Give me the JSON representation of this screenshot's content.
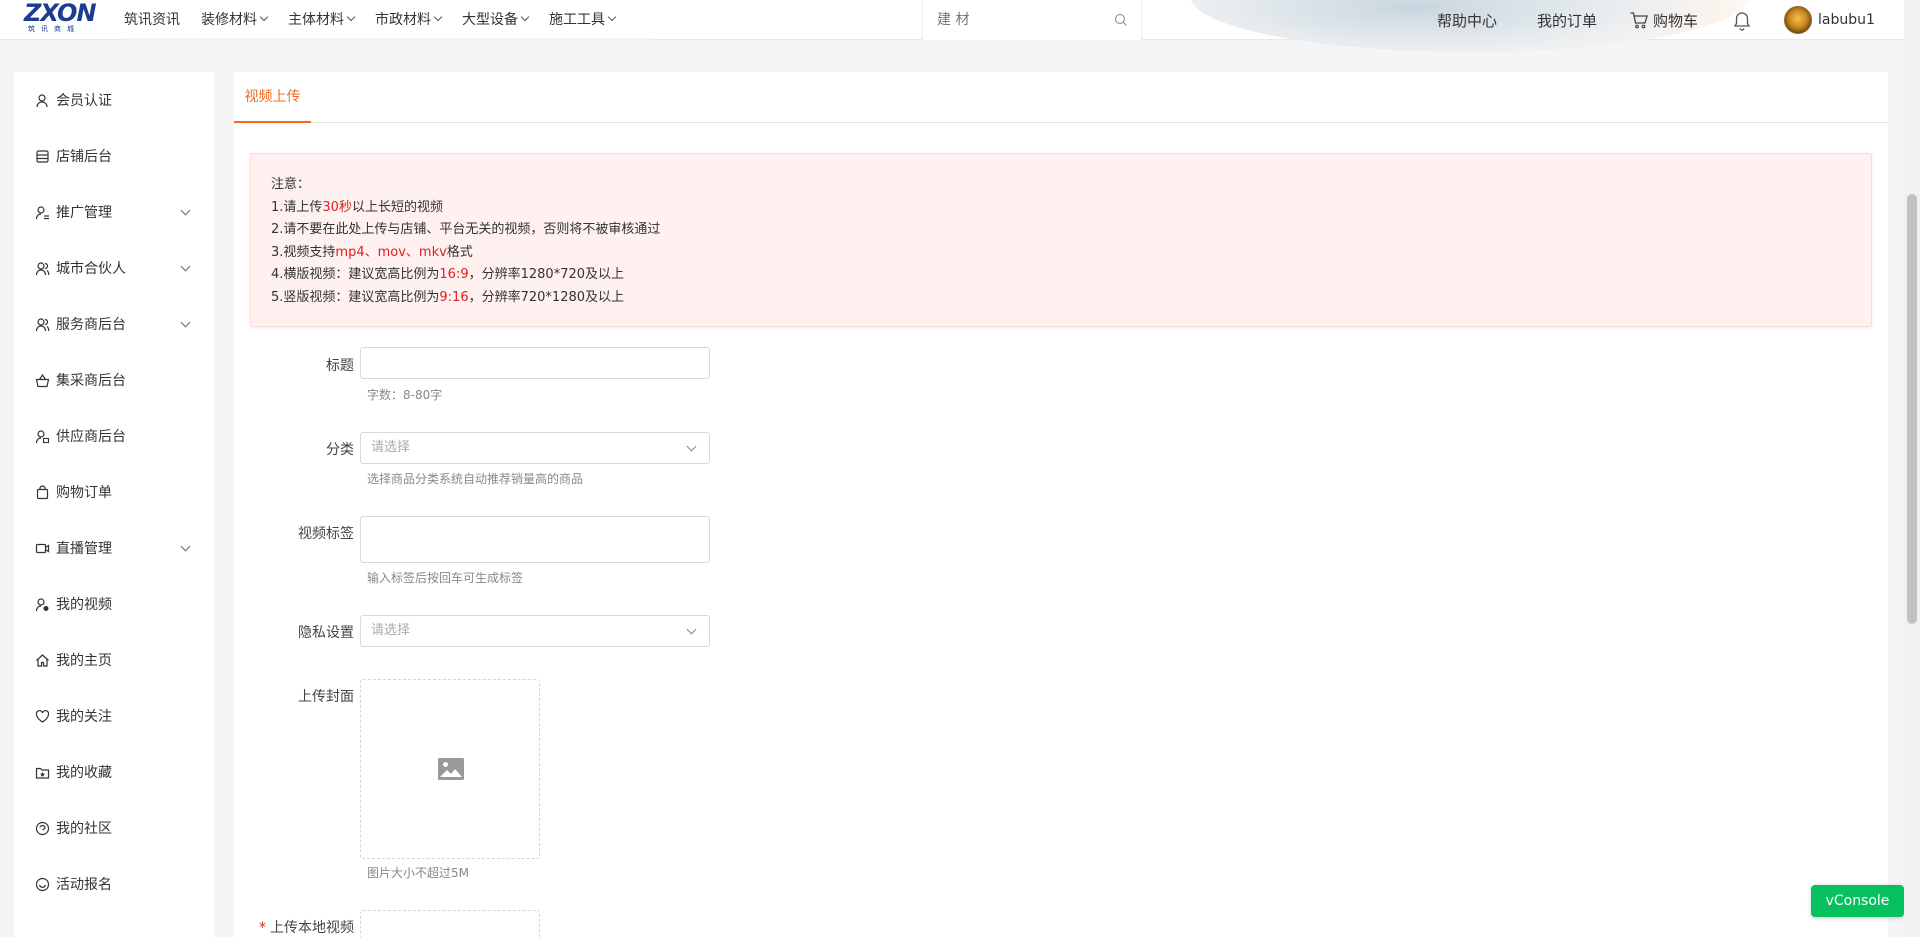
{
  "brand": {
    "logo_text": "ZXON",
    "logo_sub": "筑讯商城"
  },
  "nav": {
    "items": [
      {
        "label": "筑讯资讯",
        "has_menu": false
      },
      {
        "label": "装修材料",
        "has_menu": true
      },
      {
        "label": "主体材料",
        "has_menu": true
      },
      {
        "label": "市政材料",
        "has_menu": true
      },
      {
        "label": "大型设备",
        "has_menu": true
      },
      {
        "label": "施工工具",
        "has_menu": true
      }
    ]
  },
  "search": {
    "placeholder": "建 材",
    "icon": "search-icon"
  },
  "header_links": {
    "help": "帮助中心",
    "orders": "我的订单",
    "cart": "购物车"
  },
  "user": {
    "name": "labubu1"
  },
  "sidebar": {
    "items": [
      {
        "label": "会员认证",
        "icon": "member-icon",
        "expandable": false
      },
      {
        "label": "店铺后台",
        "icon": "store-icon",
        "expandable": false
      },
      {
        "label": "推广管理",
        "icon": "promotion-icon",
        "expandable": true
      },
      {
        "label": "城市合伙人",
        "icon": "partner-icon",
        "expandable": true
      },
      {
        "label": "服务商后台",
        "icon": "service-icon",
        "expandable": true
      },
      {
        "label": "集采商后台",
        "icon": "basket-icon",
        "expandable": false
      },
      {
        "label": "供应商后台",
        "icon": "supplier-icon",
        "expandable": false
      },
      {
        "label": "购物订单",
        "icon": "bag-icon",
        "expandable": false
      },
      {
        "label": "直播管理",
        "icon": "video-camera-icon",
        "expandable": true
      },
      {
        "label": "我的视频",
        "icon": "user-video-icon",
        "expandable": false
      },
      {
        "label": "我的主页",
        "icon": "home-icon",
        "expandable": false
      },
      {
        "label": "我的关注",
        "icon": "heart-icon",
        "expandable": false
      },
      {
        "label": "我的收藏",
        "icon": "star-folder-icon",
        "expandable": false
      },
      {
        "label": "我的社区",
        "icon": "community-icon",
        "expandable": false
      },
      {
        "label": "活动报名",
        "icon": "event-icon",
        "expandable": false
      }
    ]
  },
  "tab": {
    "label": "视频上传"
  },
  "notice": {
    "title": "注意：",
    "lines": [
      {
        "pre": "1.请上传",
        "red": "30秒",
        "post": "以上长短的视频"
      },
      {
        "pre": "2.请不要在此处上传与店铺、平台无关的视频，否则将不被审核通过",
        "red": "",
        "post": ""
      },
      {
        "pre": "3.视频支持",
        "red": "mp4、mov、mkv",
        "post": "格式"
      },
      {
        "pre": "4.横版视频：建议宽高比例为",
        "red": "16:9",
        "post": "，分辨率1280*720及以上"
      },
      {
        "pre": "5.竖版视频：建议宽高比例为",
        "red": "9:16",
        "post": "，分辨率720*1280及以上"
      }
    ]
  },
  "form": {
    "title": {
      "label": "标题",
      "hint": "字数：8-80字"
    },
    "category": {
      "label": "分类",
      "placeholder": "请选择",
      "hint": "选择商品分类系统自动推荐销量高的商品"
    },
    "tags": {
      "label": "视频标签",
      "hint": "输入标签后按回车可生成标签"
    },
    "privacy": {
      "label": "隐私设置",
      "placeholder": "请选择"
    },
    "cover": {
      "label": "上传封面",
      "hint": "图片大小不超过5M"
    },
    "video": {
      "required_mark": "*",
      "label": "上传本地视频"
    }
  },
  "vconsole": {
    "label": "vConsole"
  },
  "colors": {
    "accent": "#f26b1d",
    "warning_red": "#e02020",
    "brand_blue": "#1b3c8f",
    "vconsole_green": "#07c160"
  }
}
